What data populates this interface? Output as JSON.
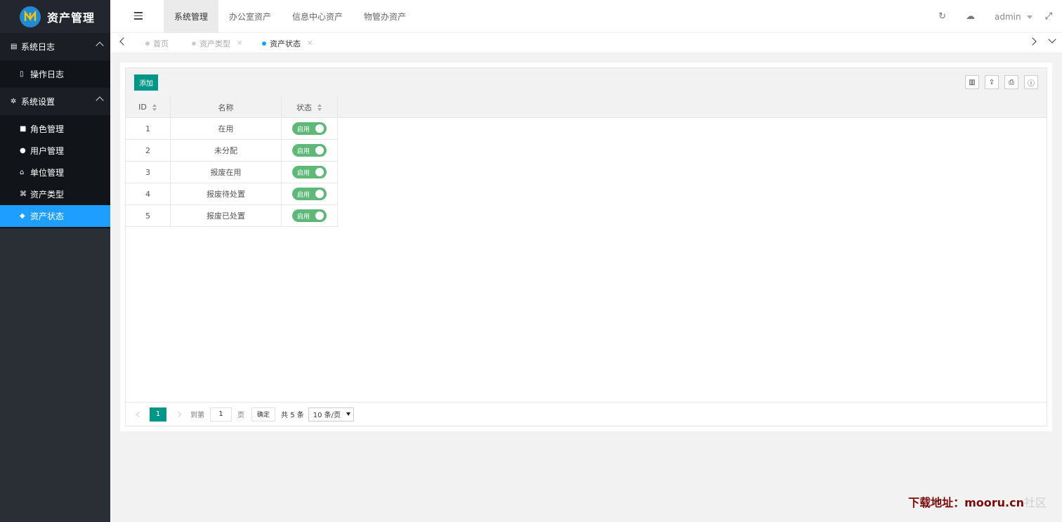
{
  "app": {
    "title": "资产管理",
    "colors": {
      "accent": "#009688",
      "sidebar_active": "#1e9fff",
      "switch_on": "#5fb878"
    }
  },
  "sidebar": {
    "groups": [
      {
        "label": "系统日志",
        "icon": "file-icon",
        "items": [
          {
            "label": "操作日志",
            "icon": "file-text-icon"
          }
        ]
      },
      {
        "label": "系统设置",
        "icon": "gears-icon",
        "items": [
          {
            "label": "角色管理",
            "icon": "lock-icon"
          },
          {
            "label": "用户管理",
            "icon": "user-icon"
          },
          {
            "label": "单位管理",
            "icon": "bank-icon"
          },
          {
            "label": "资产类型",
            "icon": "sitemap-icon"
          },
          {
            "label": "资产状态",
            "icon": "cube-icon",
            "active": true
          }
        ]
      }
    ]
  },
  "header": {
    "tabs": [
      "系统管理",
      "办公室资产",
      "信息中心资产",
      "物管办资产"
    ],
    "active_tab": "系统管理",
    "user": "admin"
  },
  "page_tabs": [
    {
      "label": "首页",
      "closable": false
    },
    {
      "label": "资产类型",
      "closable": true,
      "close": "×"
    },
    {
      "label": "资产状态",
      "closable": true,
      "close": "×",
      "active": true
    }
  ],
  "toolbar": {
    "add_label": "添加"
  },
  "table": {
    "columns": [
      "ID",
      "名称",
      "状态"
    ],
    "rows": [
      {
        "id": "1",
        "name": "在用",
        "status": "启用"
      },
      {
        "id": "2",
        "name": "未分配",
        "status": "启用"
      },
      {
        "id": "3",
        "name": "报废在用",
        "status": "启用"
      },
      {
        "id": "4",
        "name": "报废待处置",
        "status": "启用"
      },
      {
        "id": "5",
        "name": "报废已处置",
        "status": "启用"
      }
    ]
  },
  "pager": {
    "current": "1",
    "goto_label": "到第",
    "goto_value": "1",
    "page_unit": "页",
    "confirm_label": "确定",
    "total_label": "共 5 条",
    "page_size": "10 条/页"
  },
  "watermark": {
    "strong": "下载地址：mooru.cn",
    "faint": "社区"
  }
}
